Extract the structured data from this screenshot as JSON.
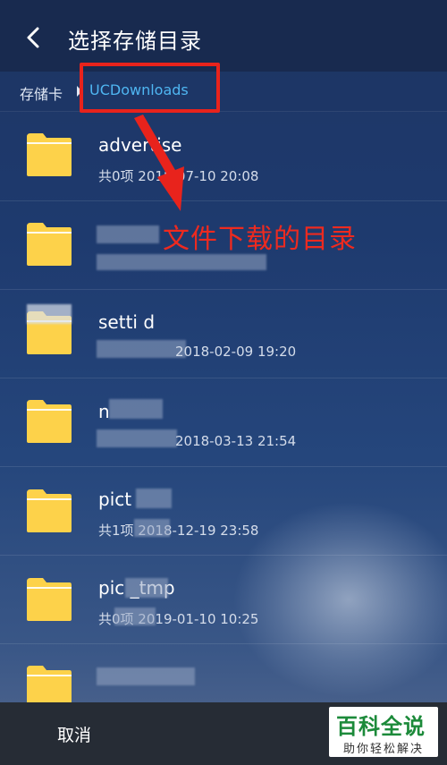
{
  "header": {
    "title": "选择存储目录",
    "back_icon": "chevron-left-icon"
  },
  "breadcrumb": {
    "root": "存储卡",
    "current": "UCDownloads"
  },
  "folders": [
    {
      "name": "advertise",
      "meta": "共0项   2018-07-10 20:08"
    },
    {
      "name": "",
      "meta": ""
    },
    {
      "name": "setti      d",
      "meta": "2018-02-09 19:20"
    },
    {
      "name": "n",
      "meta": "2018-03-13 21:54"
    },
    {
      "name": "pict",
      "meta": "共1项   2018-12-19 23:58"
    },
    {
      "name": "pic      _tmp",
      "meta": "共0项  2019-01-10 10:25"
    },
    {
      "name": "",
      "meta": ""
    }
  ],
  "annotation": {
    "text": "文件下载的目录",
    "color": "#ee2a1f"
  },
  "footer": {
    "cancel_label": "取消"
  },
  "watermark": {
    "main": "百科全说",
    "sub": "助你轻松解决"
  },
  "colors": {
    "header_bg": "#182a4f",
    "accent": "#4fb6f2",
    "folder": "#fdd24a"
  }
}
